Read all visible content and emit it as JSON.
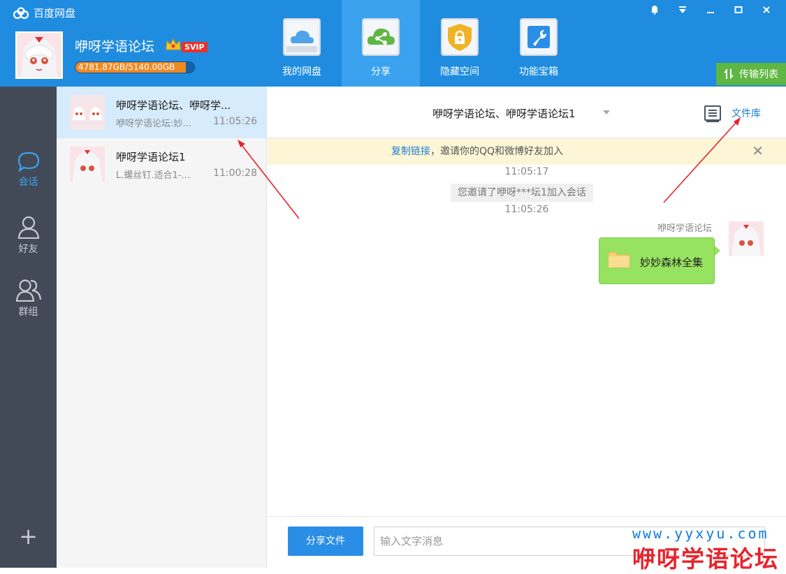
{
  "app": {
    "title": "百度网盘",
    "logo_icon": "cloud-logo-icon"
  },
  "user": {
    "name": "咿呀学语论坛",
    "vip_badge": "SVIP",
    "quota_text": "4781.87GB/5140.00GB",
    "quota_used_fraction": 0.93
  },
  "nav": [
    {
      "label": "我的网盘",
      "icon": "cloud-drive-icon",
      "active": false
    },
    {
      "label": "分享",
      "icon": "share-icon",
      "active": true
    },
    {
      "label": "隐藏空间",
      "icon": "lock-icon",
      "active": false
    },
    {
      "label": "功能宝箱",
      "icon": "wrench-icon",
      "active": false
    }
  ],
  "window_controls": [
    "bell-icon",
    "dropdown-icon",
    "minimize-icon",
    "maximize-icon",
    "close-icon"
  ],
  "transfer_button": "传输列表",
  "rail": {
    "items": [
      {
        "label": "会话",
        "icon": "chat-icon",
        "active": true
      },
      {
        "label": "好友",
        "icon": "friend-icon",
        "active": false
      },
      {
        "label": "群组",
        "icon": "group-icon",
        "active": false
      }
    ],
    "add_symbol": "+"
  },
  "conversations": [
    {
      "title": "咿呀学语论坛、咿呀学...",
      "preview": "咿呀学语论坛:妙...",
      "time": "11:05:26",
      "active": true
    },
    {
      "title": "咿呀学语论坛1",
      "preview": "L.螺丝钉.适合1-...",
      "time": "11:00:28",
      "active": false
    }
  ],
  "chat": {
    "title": "咿呀学语论坛、咿呀学语论坛1",
    "file_library": "文件库",
    "banner": {
      "link": "复制链接",
      "text": "，邀请你的QQ和微博好友加入",
      "close": "✕"
    },
    "time1": "11:05:17",
    "system_message": "您邀请了咿呀***坛1加入会话",
    "time2": "11:05:26",
    "message": {
      "sender": "咿呀学语论坛",
      "folder_name": "妙妙森林全集"
    },
    "share_file_button": "分享文件",
    "input_placeholder": "输入文字消息"
  },
  "watermark": {
    "url": "www.yyxyu.com",
    "name": "咿呀学语论坛"
  },
  "colors": {
    "header": "#1f8ce0",
    "rail": "#424a57",
    "accent": "#3aa2ef",
    "bubble": "#97e260",
    "arrow": "#e8232c"
  }
}
